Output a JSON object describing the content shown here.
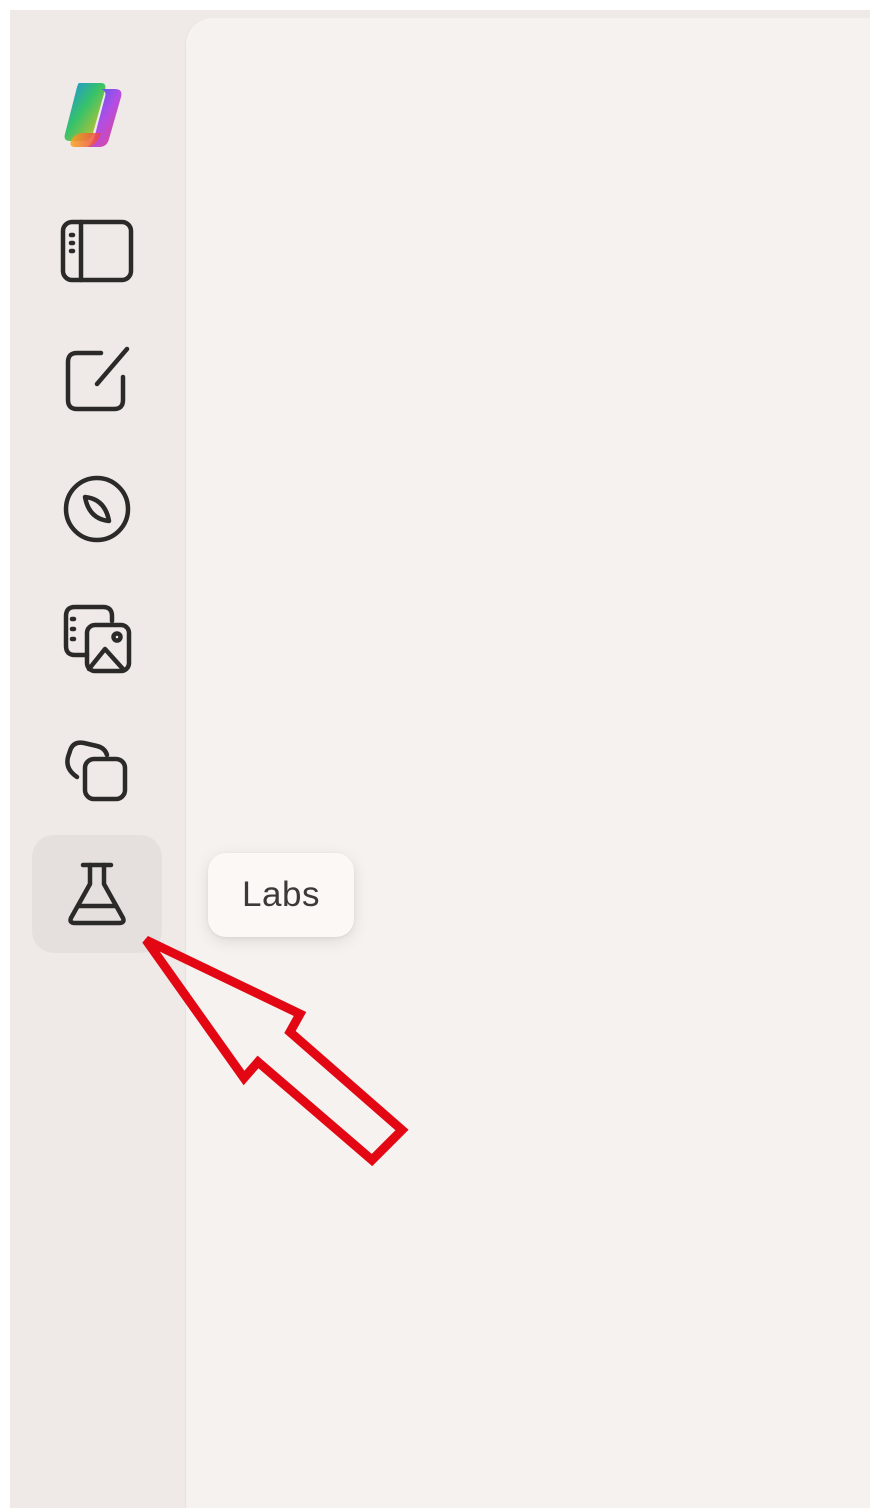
{
  "app": {
    "name": "Copilot"
  },
  "sidebar": {
    "items": [
      {
        "name": "copilot-logo",
        "icon": "copilot-logo-icon"
      },
      {
        "name": "sidebar-toggle",
        "icon": "sidebar-panel-icon"
      },
      {
        "name": "new-chat",
        "icon": "compose-icon"
      },
      {
        "name": "discover",
        "icon": "compass-icon"
      },
      {
        "name": "create-image",
        "icon": "image-gallery-icon"
      },
      {
        "name": "pages",
        "icon": "stacked-squares-icon"
      },
      {
        "name": "labs",
        "icon": "flask-icon",
        "active": true
      }
    ]
  },
  "tooltip": {
    "text": "Labs"
  },
  "annotation": {
    "type": "arrow",
    "color": "#e30613",
    "points_to": "labs"
  },
  "colors": {
    "sidebar_bg": "#efeae8",
    "main_bg": "#f6f2f0",
    "icon_stroke": "#2b2a29",
    "active_bg": "#e5e0de"
  }
}
